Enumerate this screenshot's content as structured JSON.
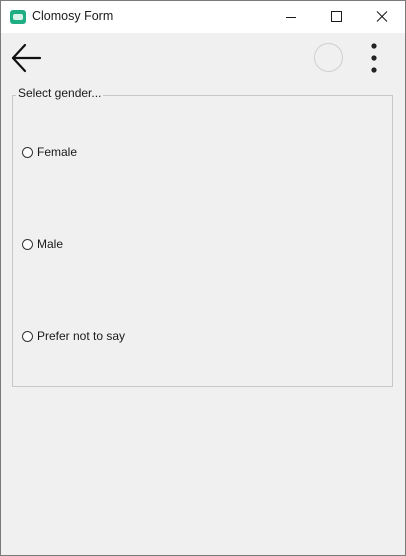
{
  "window": {
    "title": "Clomosy Form",
    "app_icon": "clomosy-logo-icon",
    "controls": [
      "minimize-icon",
      "maximize-icon",
      "close-icon"
    ]
  },
  "toolbar": {
    "back_icon": "arrow-left-icon",
    "status_icon": "loading-circle-icon",
    "menu_icon": "more-vertical-icon"
  },
  "gender_group": {
    "legend": "Select gender...",
    "options": [
      {
        "label": "Female",
        "selected": false
      },
      {
        "label": "Male",
        "selected": false
      },
      {
        "label": "Prefer not to say",
        "selected": false
      }
    ]
  },
  "colors": {
    "window_bg": "#f0f0f0",
    "titlebar_bg": "#ffffff",
    "app_icon": "#1fae84",
    "group_border": "#c8c8c8"
  }
}
